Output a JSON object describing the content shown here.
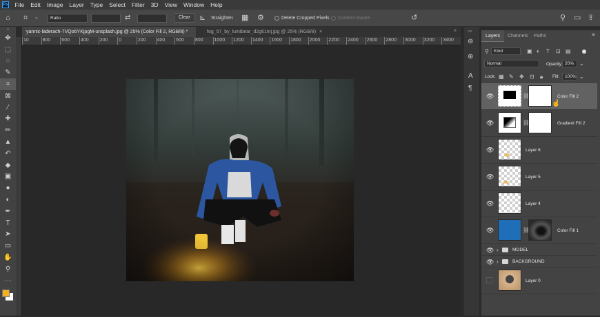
{
  "app": {
    "logo": "Ps"
  },
  "menu": [
    "File",
    "Edit",
    "Image",
    "Layer",
    "Type",
    "Select",
    "Filter",
    "3D",
    "View",
    "Window",
    "Help"
  ],
  "options": {
    "ratio_label": "Ratio",
    "clear_label": "Clear",
    "straighten_label": "Straighten",
    "delete_cropped_label": "Delete Cropped Pixels",
    "content_aware_label": "Content-Aware"
  },
  "tabs": [
    {
      "label": "yannic-laderach-7VQo6YKjpgM-unsplash.jpg @ 25% (Color Fill 2, RGB/8) *",
      "close": "×"
    },
    {
      "label": "fog_57_by_lumibear_d2g61mj.jpg @ 25% (RGB/8)",
      "close": "×"
    }
  ],
  "ruler": {
    "labels": [
      "10",
      "800",
      "600",
      "400",
      "200",
      "0",
      "200",
      "400",
      "600",
      "800",
      "1000",
      "1200",
      "1400",
      "1600",
      "1800",
      "2000",
      "2200",
      "2400",
      "2600",
      "2800",
      "3000",
      "3200",
      "3400"
    ]
  },
  "panel": {
    "tabs": [
      "Layers",
      "Channels",
      "Paths"
    ],
    "filter_kind": "Kind",
    "blend_mode": "Normal",
    "opacity_label": "Opacity:",
    "opacity_value": "20%",
    "lock_label": "Lock:",
    "fill_label": "Fill:",
    "fill_value": "100%"
  },
  "layers": [
    {
      "name": "Color Fill 2",
      "type": "fill-black-mask",
      "selected": true
    },
    {
      "name": "Gradient Fill 2",
      "type": "gradient-mask",
      "selected": false
    },
    {
      "name": "Layer 6",
      "type": "transparent",
      "selected": false
    },
    {
      "name": "Layer 5",
      "type": "transparent",
      "selected": false
    },
    {
      "name": "Layer 4",
      "type": "transparent",
      "selected": false
    },
    {
      "name": "Color Fill 1",
      "type": "fill-blue-mask",
      "selected": false
    },
    {
      "name": "MODEL",
      "type": "group",
      "selected": false
    },
    {
      "name": "BACKGROUND",
      "type": "group",
      "selected": false
    },
    {
      "name": "Layer 0",
      "type": "photo",
      "selected": false
    }
  ],
  "colors": {
    "foreground": "#f2b01e",
    "background": "#ffffff",
    "accent": "#31a8ff"
  }
}
